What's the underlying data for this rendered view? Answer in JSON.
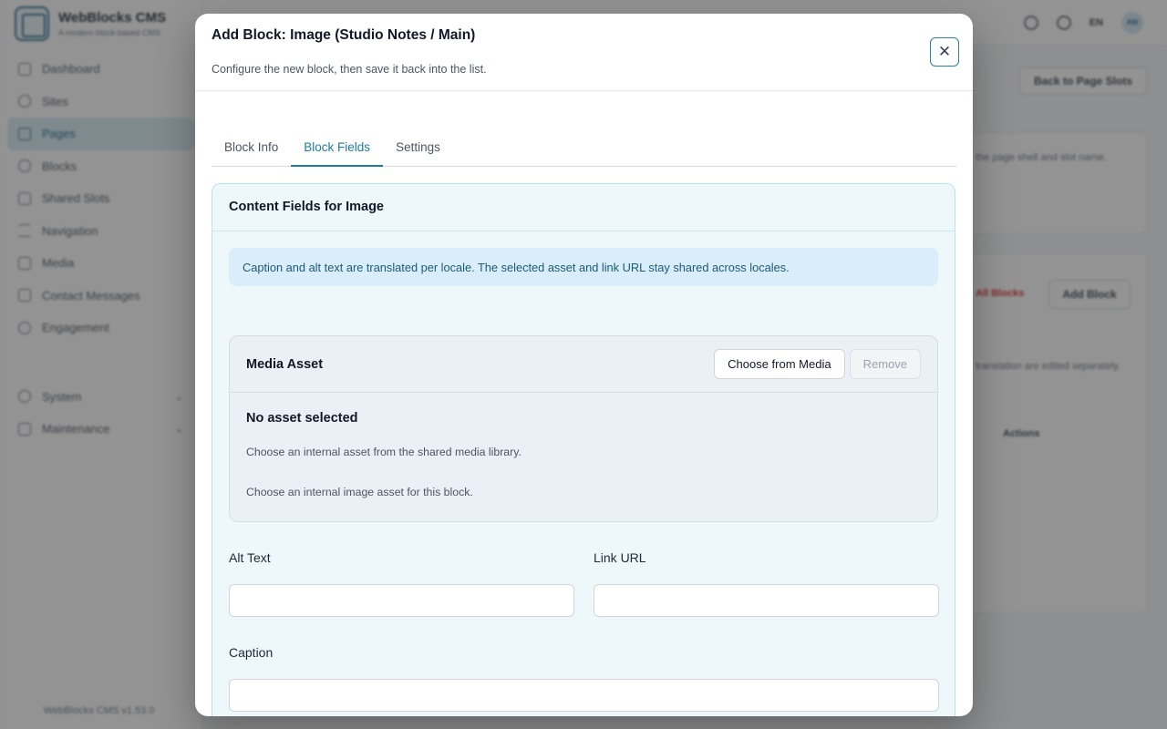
{
  "app": {
    "brand_name": "WebBlocks CMS",
    "brand_tagline": "A modern block-based CMS",
    "version": "WebBlocks CMS v1.53.0",
    "nav": [
      {
        "label": "Dashboard",
        "icon": "dashboard-icon"
      },
      {
        "label": "Sites",
        "icon": "globe-icon"
      },
      {
        "label": "Pages",
        "icon": "page-icon",
        "active": true
      },
      {
        "label": "Blocks",
        "icon": "blocks-icon"
      },
      {
        "label": "Shared Slots",
        "icon": "shared-slots-icon"
      },
      {
        "label": "Navigation",
        "icon": "menu-icon"
      },
      {
        "label": "Media",
        "icon": "media-icon"
      },
      {
        "label": "Contact Messages",
        "icon": "mail-icon"
      },
      {
        "label": "Engagement",
        "icon": "star-icon"
      }
    ],
    "nav_groups": [
      {
        "label": "System",
        "icon": "system-icon"
      },
      {
        "label": "Maintenance",
        "icon": "maintenance-icon"
      }
    ],
    "topbar": {
      "lang": "EN",
      "avatar": "AM"
    },
    "back_button": "Back to Page Slots",
    "bg_hint": "the page shell and slot name.",
    "bg_all_blocks": "All Blocks",
    "bg_add_block": "Add Block",
    "bg_translation_note": "translation are edited separately.",
    "bg_actions_header": "Actions"
  },
  "modal": {
    "title": "Add Block: Image (Studio Notes / Main)",
    "subtitle": "Configure the new block, then save it back into the list.",
    "tabs": [
      "Block Info",
      "Block Fields",
      "Settings"
    ],
    "active_tab": "Block Fields",
    "panel_title": "Content Fields for Image",
    "notice": "Caption and alt text are translated per locale. The selected asset and link URL stay shared across locales.",
    "asset": {
      "title": "Media Asset",
      "choose_label": "Choose from Media",
      "remove_label": "Remove",
      "empty_title": "No asset selected",
      "help_1": "Choose an internal asset from the shared media library.",
      "help_2": "Choose an internal image asset for this block."
    },
    "fields": {
      "alt_text": {
        "label": "Alt Text",
        "value": ""
      },
      "link_url": {
        "label": "Link URL",
        "value": ""
      },
      "caption": {
        "label": "Caption",
        "value": ""
      }
    }
  },
  "colors": {
    "accent": "#1f7aa3",
    "panel_bg": "#eef8fb",
    "notice_bg": "#d9eefa",
    "danger": "#dc2626"
  }
}
